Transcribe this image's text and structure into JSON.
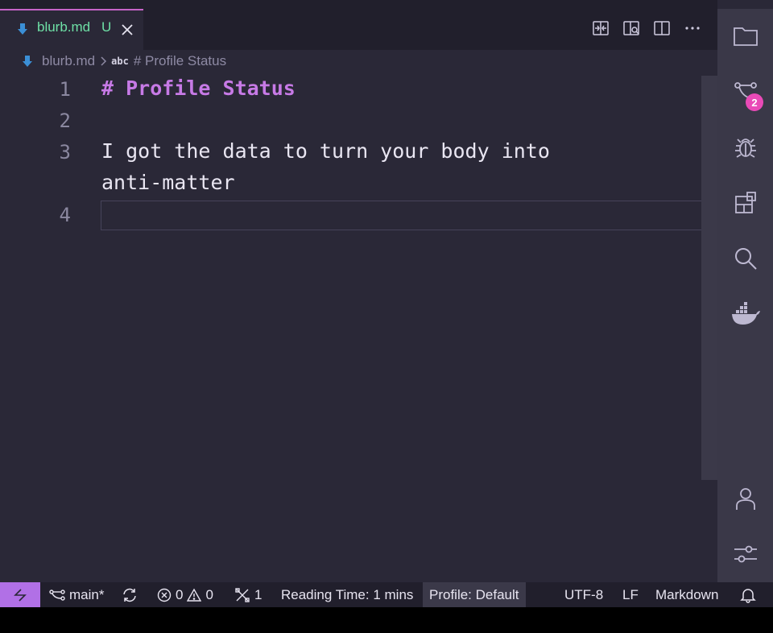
{
  "tab": {
    "filename": "blurb.md",
    "status": "U"
  },
  "breadcrumb": {
    "file": "blurb.md",
    "symbol_kind": "abc",
    "symbol": "# Profile Status"
  },
  "editor": {
    "lines": [
      {
        "number": "1",
        "text": "# Profile Status"
      },
      {
        "number": "2",
        "text": ""
      },
      {
        "number": "3",
        "text": "I got the data to turn your body into",
        "wrap": "anti-matter"
      },
      {
        "number": "4",
        "text": ""
      }
    ]
  },
  "activity_bar": {
    "items": [
      "folder-icon",
      "source-control-icon",
      "debug-icon",
      "extensions-icon",
      "search-icon",
      "docker-icon",
      "account-icon",
      "settings-icon"
    ],
    "source_control_badge": "2"
  },
  "status_bar": {
    "branch": "main*",
    "errors": "0",
    "warnings": "0",
    "tools": "1",
    "reading_time": "Reading Time: 1 mins",
    "profile": "Profile: Default",
    "encoding": "UTF-8",
    "eol": "LF",
    "language": "Markdown"
  },
  "colors": {
    "accent": "#c764c9",
    "heading": "#c77ae6",
    "untracked": "#6ee0a6",
    "badge": "#e94ab7",
    "remote": "#b170e6"
  }
}
